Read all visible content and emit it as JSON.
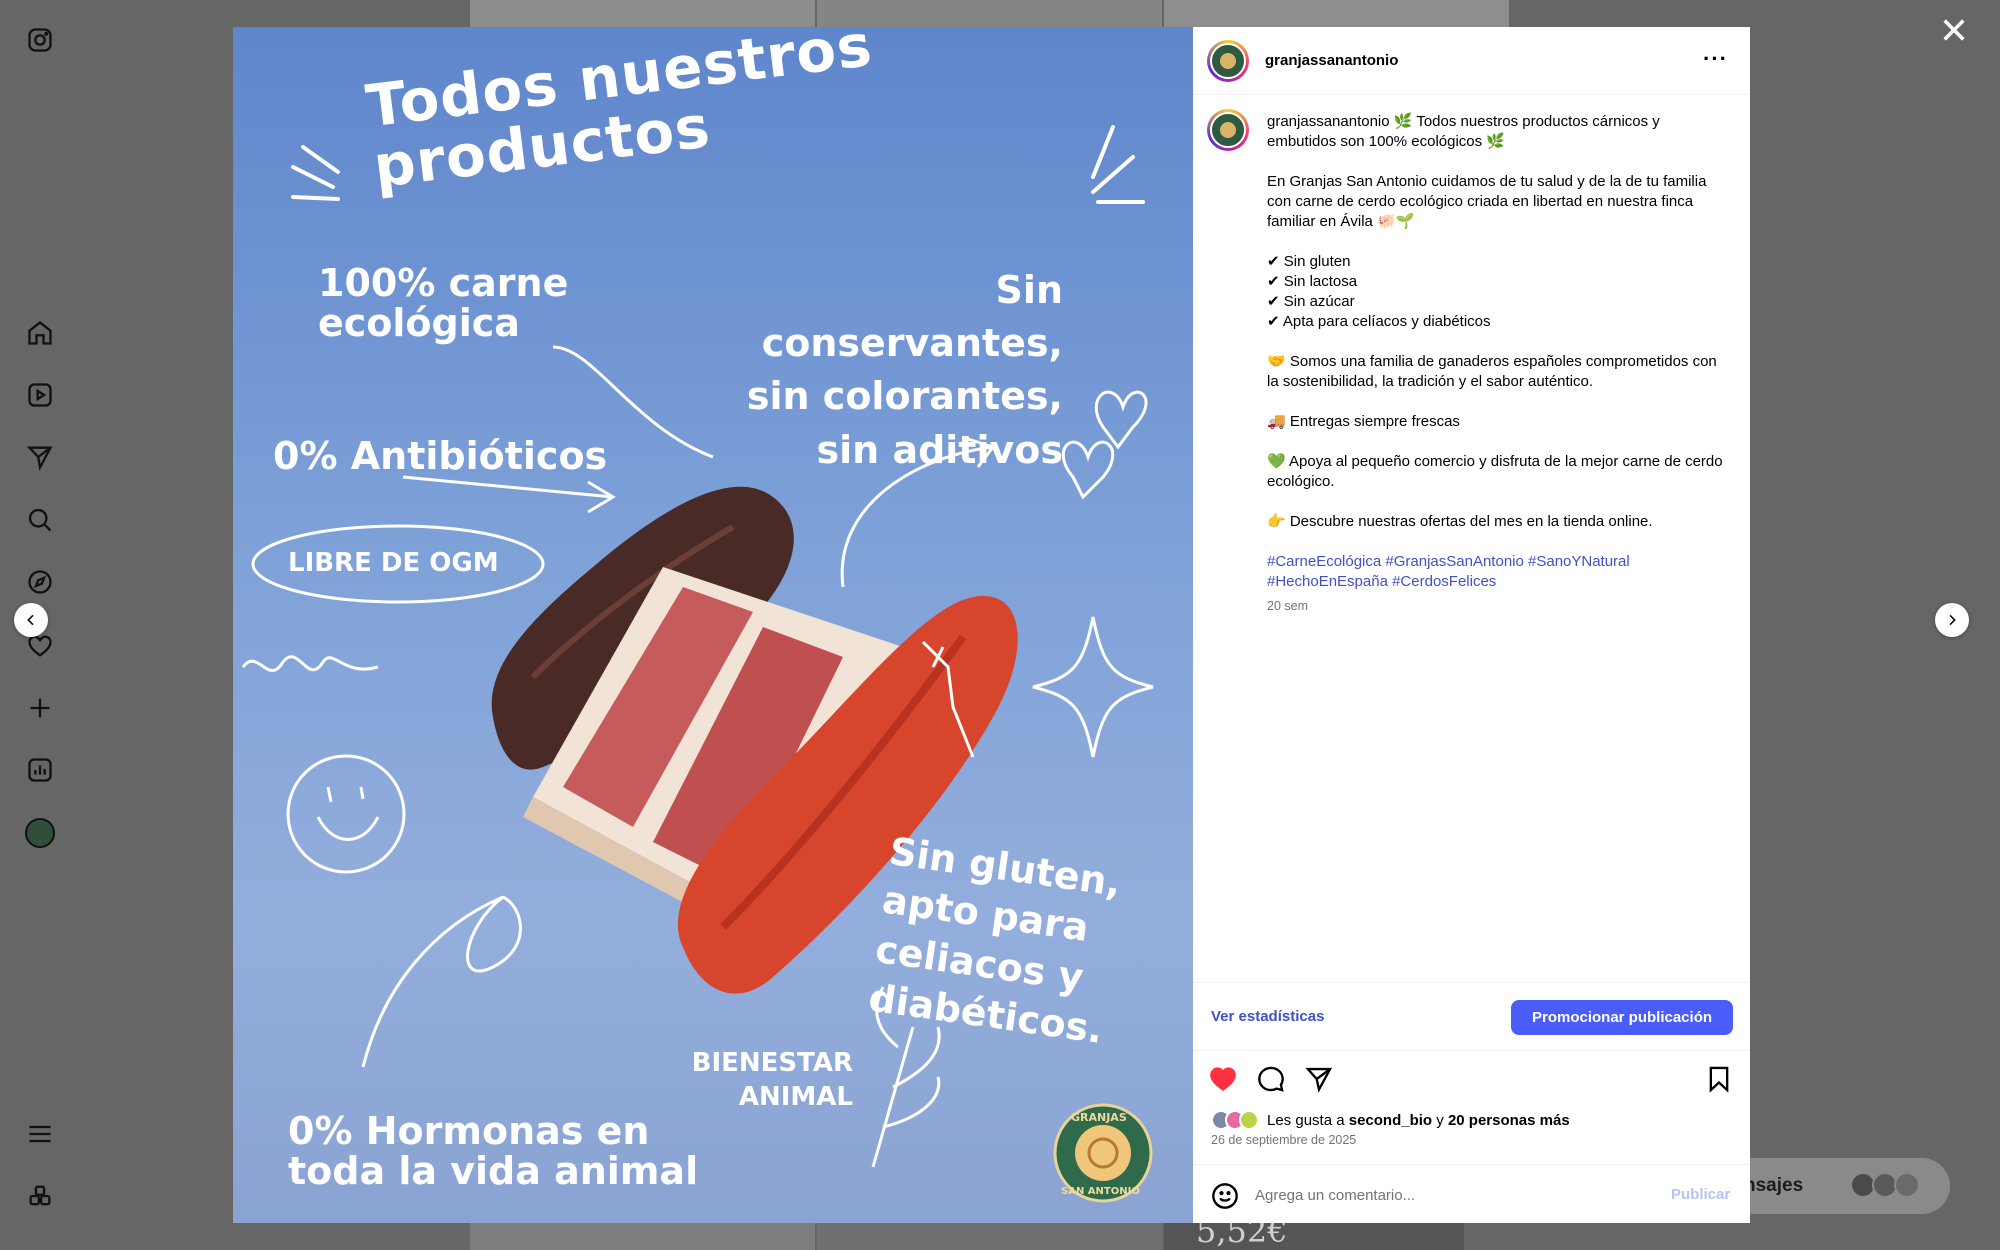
{
  "nav": {
    "icons": [
      "instagram-icon",
      "home-icon",
      "reels-icon",
      "direct-icon",
      "search-icon",
      "explore-icon",
      "heart-icon",
      "create-icon",
      "dashboard-icon",
      "profile-avatar",
      "menu-icon",
      "apps-icon"
    ]
  },
  "background": {
    "price": "5,52€",
    "messages_label": "nsajes"
  },
  "image": {
    "title": "Todos nuestros productos",
    "claim_1": "100% carne ecológica",
    "claim_2": "Sin conservantes, sin colorantes, sin aditivos",
    "claim_3": "0% Antibióticos",
    "claim_4": "LIBRE DE OGM",
    "claim_5": "Sin gluten, apto para celiacos y diabéticos.",
    "claim_6": "BIENESTAR ANIMAL",
    "claim_7": "0% Hormonas en toda la vida animal",
    "logo_text_top": "GRANJAS",
    "logo_text_bottom": "SAN ANTONIO"
  },
  "post": {
    "username": "granjassanantonio",
    "caption_intro": "🌿 Todos nuestros productos cárnicos y embutidos son 100% ecológicos 🌿",
    "caption_p1": "En Granjas San Antonio cuidamos de tu salud y de la de tu familia con carne de cerdo ecológico criada en libertad en nuestra finca familiar en Ávila 🐖🌱",
    "checks": [
      "✔ Sin gluten",
      "✔ Sin lactosa",
      "✔ Sin azúcar",
      "✔ Apta para celíacos y diabéticos"
    ],
    "caption_p2": "🤝 Somos una familia de ganaderos españoles comprometidos con la sostenibilidad, la tradición y el sabor auténtico.",
    "caption_p3": "🚚 Entregas siempre frescas",
    "caption_p4": "💚 Apoya al pequeño comercio y disfruta de la mejor carne de cerdo ecológico.",
    "caption_p5": "👉 Descubre nuestras ofertas del mes en la tienda online.",
    "hashtags": "#CarneEcológica #GranjasSanAntonio #SanoYNatural #HechoEnEspaña #CerdosFelices",
    "time_ago": "20 sem",
    "stats_label": "Ver estadísticas",
    "promote_label": "Promocionar publicación",
    "likes_prefix": "Les gusta a ",
    "likes_user": "second_bio",
    "likes_mid": " y ",
    "likes_count": "20 personas más",
    "date": "26 de septiembre de 2025",
    "comment_placeholder": "Agrega un comentario...",
    "publish_label": "Publicar"
  },
  "colors": {
    "accent": "#4a5df9",
    "link": "#4150c7",
    "like": "#ff3040",
    "image_bg": "#7fa2d8"
  }
}
